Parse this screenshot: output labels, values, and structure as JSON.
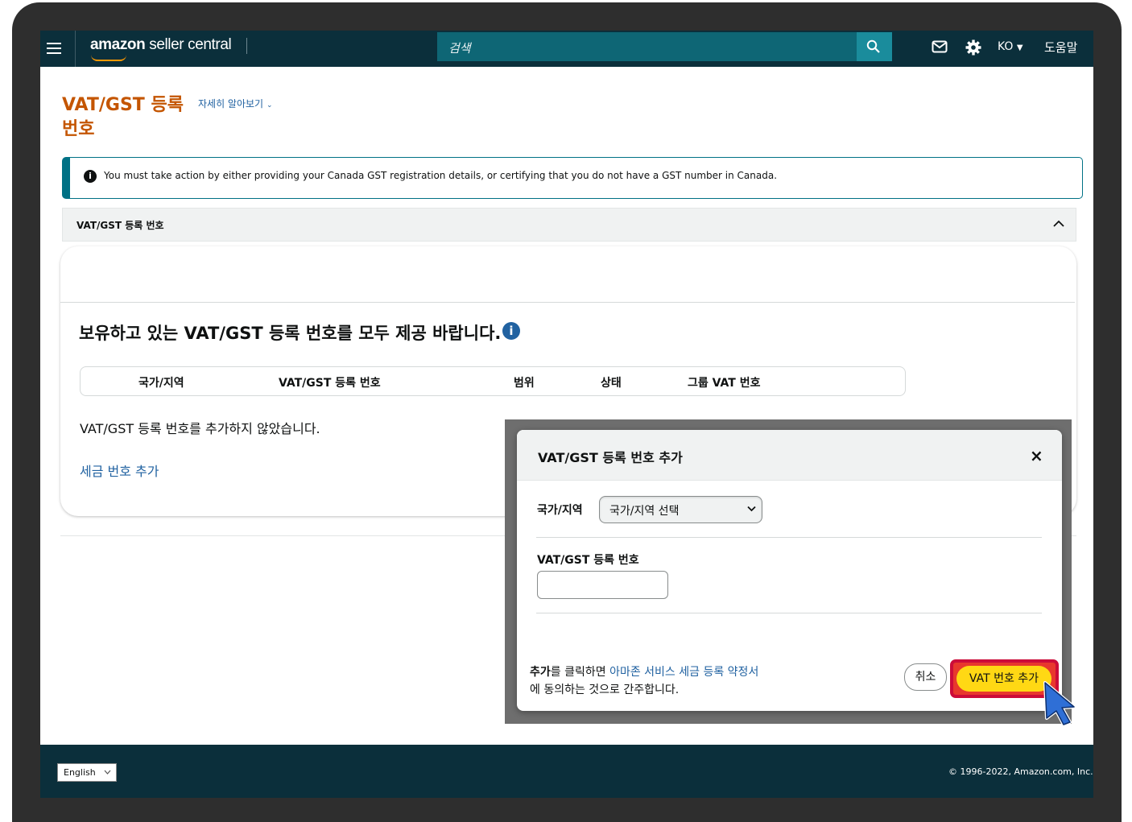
{
  "topbar": {
    "brand_bold": "amazon",
    "brand_rest": " seller central",
    "search_placeholder": "검색",
    "language": "KO",
    "help": "도움말"
  },
  "page": {
    "title": "VAT/GST 등록 번호",
    "learn_more": "자세히 알아보기"
  },
  "alert": {
    "text": "You must take action by either providing your Canada GST registration details, or certifying that you do not have a GST number in Canada."
  },
  "accordion": {
    "title": "VAT/GST 등록 번호"
  },
  "section": {
    "heading": "보유하고 있는 VAT/GST 등록 번호를 모두 제공 바랍니다.",
    "columns": [
      "국가/지역",
      "VAT/GST 등록 번호",
      "범위",
      "상태",
      "그룹 VAT 번호"
    ],
    "empty_text": "VAT/GST 등록 번호를 추가하지 않았습니다.",
    "add_link": "세금 번호 추가"
  },
  "modal": {
    "title": "VAT/GST 등록 번호 추가",
    "close": "×",
    "country_label": "국가/지역",
    "country_select": "국가/지역 선택",
    "vat_label": "VAT/GST 등록 번호",
    "vat_value": "",
    "terms_bold": "추가",
    "terms_pre": "를 클릭하면 ",
    "terms_link": "아마존 서비스 세금 등록 약정서",
    "terms_post": "에 동의하는 것으로 간주합니다.",
    "cancel": "취소",
    "add": "VAT 번호 추가"
  },
  "footer": {
    "language": "English",
    "copyright": "© 1996-2022, Amazon.com, Inc."
  },
  "colors": {
    "nav_bg": "#0b2f3b",
    "title_orange": "#c45500",
    "link_blue": "#2162a1",
    "teal": "#007185",
    "primary_yellow": "#ffd814",
    "highlight_red": "#cc0c39"
  }
}
